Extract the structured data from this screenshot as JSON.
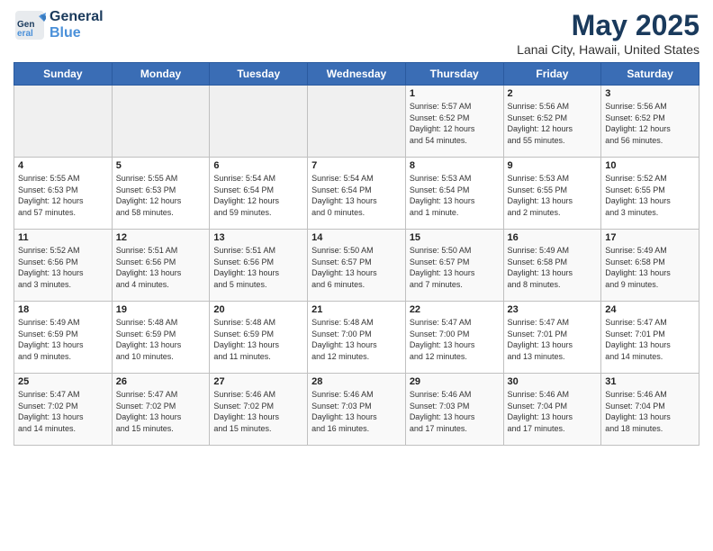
{
  "header": {
    "logo_general": "General",
    "logo_blue": "Blue",
    "title": "May 2025",
    "subtitle": "Lanai City, Hawaii, United States"
  },
  "days_of_week": [
    "Sunday",
    "Monday",
    "Tuesday",
    "Wednesday",
    "Thursday",
    "Friday",
    "Saturday"
  ],
  "weeks": [
    [
      {
        "day": "",
        "info": ""
      },
      {
        "day": "",
        "info": ""
      },
      {
        "day": "",
        "info": ""
      },
      {
        "day": "",
        "info": ""
      },
      {
        "day": "1",
        "info": "Sunrise: 5:57 AM\nSunset: 6:52 PM\nDaylight: 12 hours\nand 54 minutes."
      },
      {
        "day": "2",
        "info": "Sunrise: 5:56 AM\nSunset: 6:52 PM\nDaylight: 12 hours\nand 55 minutes."
      },
      {
        "day": "3",
        "info": "Sunrise: 5:56 AM\nSunset: 6:52 PM\nDaylight: 12 hours\nand 56 minutes."
      }
    ],
    [
      {
        "day": "4",
        "info": "Sunrise: 5:55 AM\nSunset: 6:53 PM\nDaylight: 12 hours\nand 57 minutes."
      },
      {
        "day": "5",
        "info": "Sunrise: 5:55 AM\nSunset: 6:53 PM\nDaylight: 12 hours\nand 58 minutes."
      },
      {
        "day": "6",
        "info": "Sunrise: 5:54 AM\nSunset: 6:54 PM\nDaylight: 12 hours\nand 59 minutes."
      },
      {
        "day": "7",
        "info": "Sunrise: 5:54 AM\nSunset: 6:54 PM\nDaylight: 13 hours\nand 0 minutes."
      },
      {
        "day": "8",
        "info": "Sunrise: 5:53 AM\nSunset: 6:54 PM\nDaylight: 13 hours\nand 1 minute."
      },
      {
        "day": "9",
        "info": "Sunrise: 5:53 AM\nSunset: 6:55 PM\nDaylight: 13 hours\nand 2 minutes."
      },
      {
        "day": "10",
        "info": "Sunrise: 5:52 AM\nSunset: 6:55 PM\nDaylight: 13 hours\nand 3 minutes."
      }
    ],
    [
      {
        "day": "11",
        "info": "Sunrise: 5:52 AM\nSunset: 6:56 PM\nDaylight: 13 hours\nand 3 minutes."
      },
      {
        "day": "12",
        "info": "Sunrise: 5:51 AM\nSunset: 6:56 PM\nDaylight: 13 hours\nand 4 minutes."
      },
      {
        "day": "13",
        "info": "Sunrise: 5:51 AM\nSunset: 6:56 PM\nDaylight: 13 hours\nand 5 minutes."
      },
      {
        "day": "14",
        "info": "Sunrise: 5:50 AM\nSunset: 6:57 PM\nDaylight: 13 hours\nand 6 minutes."
      },
      {
        "day": "15",
        "info": "Sunrise: 5:50 AM\nSunset: 6:57 PM\nDaylight: 13 hours\nand 7 minutes."
      },
      {
        "day": "16",
        "info": "Sunrise: 5:49 AM\nSunset: 6:58 PM\nDaylight: 13 hours\nand 8 minutes."
      },
      {
        "day": "17",
        "info": "Sunrise: 5:49 AM\nSunset: 6:58 PM\nDaylight: 13 hours\nand 9 minutes."
      }
    ],
    [
      {
        "day": "18",
        "info": "Sunrise: 5:49 AM\nSunset: 6:59 PM\nDaylight: 13 hours\nand 9 minutes."
      },
      {
        "day": "19",
        "info": "Sunrise: 5:48 AM\nSunset: 6:59 PM\nDaylight: 13 hours\nand 10 minutes."
      },
      {
        "day": "20",
        "info": "Sunrise: 5:48 AM\nSunset: 6:59 PM\nDaylight: 13 hours\nand 11 minutes."
      },
      {
        "day": "21",
        "info": "Sunrise: 5:48 AM\nSunset: 7:00 PM\nDaylight: 13 hours\nand 12 minutes."
      },
      {
        "day": "22",
        "info": "Sunrise: 5:47 AM\nSunset: 7:00 PM\nDaylight: 13 hours\nand 12 minutes."
      },
      {
        "day": "23",
        "info": "Sunrise: 5:47 AM\nSunset: 7:01 PM\nDaylight: 13 hours\nand 13 minutes."
      },
      {
        "day": "24",
        "info": "Sunrise: 5:47 AM\nSunset: 7:01 PM\nDaylight: 13 hours\nand 14 minutes."
      }
    ],
    [
      {
        "day": "25",
        "info": "Sunrise: 5:47 AM\nSunset: 7:02 PM\nDaylight: 13 hours\nand 14 minutes."
      },
      {
        "day": "26",
        "info": "Sunrise: 5:47 AM\nSunset: 7:02 PM\nDaylight: 13 hours\nand 15 minutes."
      },
      {
        "day": "27",
        "info": "Sunrise: 5:46 AM\nSunset: 7:02 PM\nDaylight: 13 hours\nand 15 minutes."
      },
      {
        "day": "28",
        "info": "Sunrise: 5:46 AM\nSunset: 7:03 PM\nDaylight: 13 hours\nand 16 minutes."
      },
      {
        "day": "29",
        "info": "Sunrise: 5:46 AM\nSunset: 7:03 PM\nDaylight: 13 hours\nand 17 minutes."
      },
      {
        "day": "30",
        "info": "Sunrise: 5:46 AM\nSunset: 7:04 PM\nDaylight: 13 hours\nand 17 minutes."
      },
      {
        "day": "31",
        "info": "Sunrise: 5:46 AM\nSunset: 7:04 PM\nDaylight: 13 hours\nand 18 minutes."
      }
    ]
  ]
}
